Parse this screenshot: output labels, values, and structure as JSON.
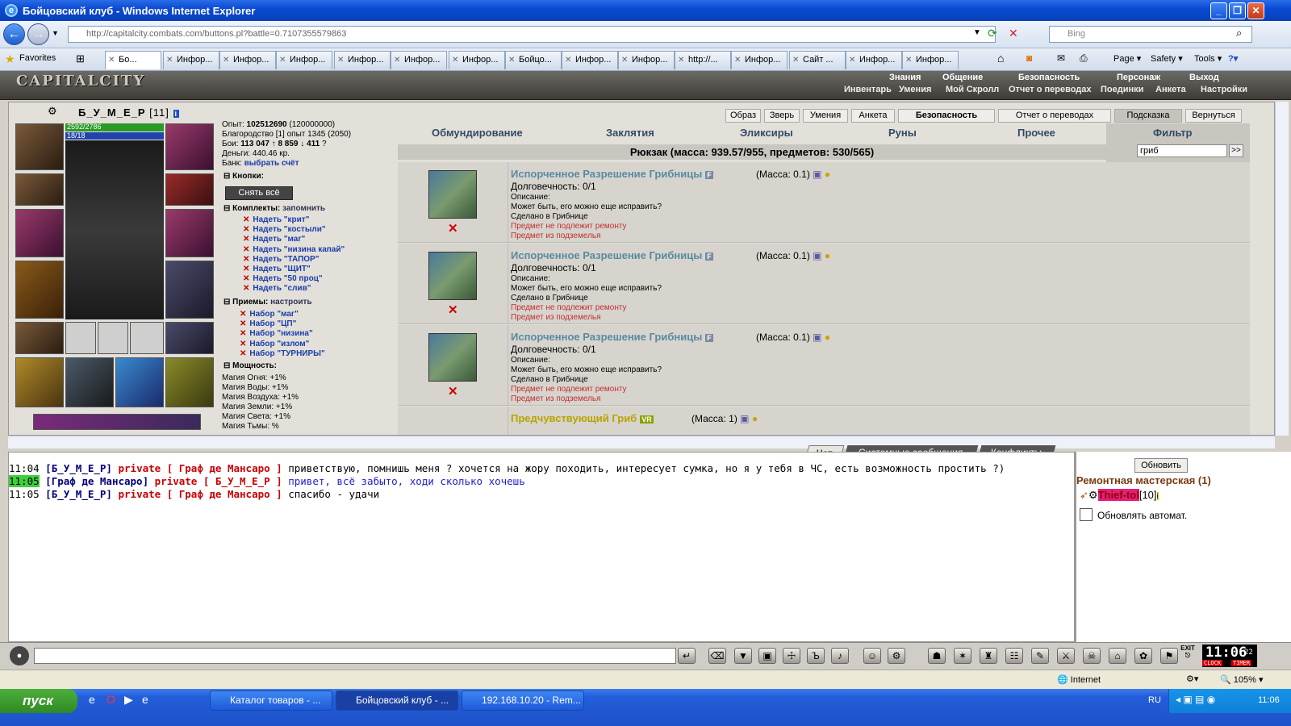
{
  "window": {
    "title": "Бойцовский клуб - Windows Internet Explorer"
  },
  "nav": {
    "address": "http://capitalcity.combats.com/buttons.pl?battle=0.7107355579863",
    "address_host": "combats.com",
    "search_placeholder": "Bing"
  },
  "favorites": "Favorites",
  "tabs": [
    "Бо...",
    "Инфор...",
    "Инфор...",
    "Инфор...",
    "Инфор...",
    "Инфор...",
    "Инфор...",
    "Бойцо...",
    "Инфор...",
    "Инфор...",
    "http://...",
    "Инфор...",
    "Сайт ...",
    "Инфор...",
    "Инфор..."
  ],
  "ie_tools": [
    "Page",
    "Safety",
    "Tools"
  ],
  "game": {
    "logo": "CAPITALCITY",
    "menu_top": [
      "Знания",
      "Общение",
      "Безопасность",
      "Персонаж",
      "Выход"
    ],
    "menu_bottom": [
      "Инвентарь",
      "Умения",
      "Мой Скролл",
      "Отчет о переводах",
      "Поединки",
      "Анкета",
      "Настройки"
    ]
  },
  "character": {
    "name": "Б_У_М_Е_Р",
    "level": "[11]",
    "hp": "2592/2786",
    "mana": "18/18",
    "experience_label": "Опыт:",
    "experience": "102512690",
    "experience_next": "(120000000)",
    "valor": "Благородство [1] опыт 1345 (2050)",
    "fights_label": "Бои:",
    "fights_wins": "113 047",
    "fights_losses": "8 859",
    "fights_draws": "411",
    "money": "Деньги: 440.46 кр.",
    "bank_label": "Банк:",
    "bank_link": "выбрать счёт"
  },
  "buttons_section": {
    "title": "Кнопки:",
    "remove_all": "Снять всё"
  },
  "sets_section": {
    "title": "Комплекты:",
    "action": "запомнить",
    "items": [
      "Надеть \"крит\"",
      "Надеть \"костыли\"",
      "Надеть \"маг\"",
      "Надеть \"низина капай\"",
      "Надеть \"ТАПОР\"",
      "Надеть \"ЩИТ\"",
      "Надеть \"50 проц\"",
      "Надеть \"слив\""
    ]
  },
  "tricks_section": {
    "title": "Приемы:",
    "action": "настроить",
    "items": [
      "Набор \"маг\"",
      "Набор \"ЦП\"",
      "Набор \"низина\"",
      "Набор \"излом\"",
      "Набор \"ТУРНИРЫ\""
    ]
  },
  "power_section": {
    "title": "Мощность:",
    "items": [
      "Магия Огня: +1%",
      "Магия Воды: +1%",
      "Магия Воздуха: +1%",
      "Магия Земли: +1%",
      "Магия Света: +1%",
      "Магия Тьмы: %"
    ]
  },
  "inventory": {
    "top_buttons": [
      "Образ",
      "Зверь",
      "Умения",
      "Анкета",
      "Безопасность",
      "Отчет о переводах",
      "Подсказка",
      "Вернуться"
    ],
    "categories": [
      "Обмундирование",
      "Заклятия",
      "Эликсиры",
      "Руны",
      "Прочее",
      "Фильтр"
    ],
    "backpack": "Рюкзак (масса: 939.57/955, предметов: 530/565)",
    "filter_value": "гриб",
    "filter_go": ">>",
    "items": [
      {
        "name": "Испорченное Разрешение Грибницы",
        "badge": "F",
        "mass": "(Масса: 0.1)",
        "durability": "Долговечность: 0/1",
        "desc_label": "Описание:",
        "desc": "Может быть, его можно еще исправить?",
        "made": "Сделано в Грибнице",
        "note1": "Предмет не подлежит ремонту",
        "note2": "Предмет из подземелья"
      },
      {
        "name": "Испорченное Разрешение Грибницы",
        "badge": "F",
        "mass": "(Масса: 0.1)",
        "durability": "Долговечность: 0/1",
        "desc_label": "Описание:",
        "desc": "Может быть, его можно еще исправить?",
        "made": "Сделано в Грибнице",
        "note1": "Предмет не подлежит ремонту",
        "note2": "Предмет из подземелья"
      },
      {
        "name": "Испорченное Разрешение Грибницы",
        "badge": "F",
        "mass": "(Масса: 0.1)",
        "durability": "Долговечность: 0/1",
        "desc_label": "Описание:",
        "desc": "Может быть, его можно еще исправить?",
        "made": "Сделано в Грибнице",
        "note1": "Предмет не подлежит ремонту",
        "note2": "Предмет из подземелья"
      },
      {
        "name": "Предчувствующий Гриб",
        "badge": "VR",
        "mass": "(Масса: 1)"
      }
    ]
  },
  "chat": {
    "tabs": [
      "Чат",
      "Системные сообщения",
      "Конфликты"
    ],
    "messages": [
      {
        "time": "11:04",
        "from": "[Б_У_М_Е_Р]",
        "private": "private [ Граф де Мансаро ]",
        "text": "приветствую, помнишь меня ? хочется на жору походить, интересует сумка, но я у тебя в ЧС, есть возможность простить ?)"
      },
      {
        "time": "11:05",
        "from": "[Граф де Мансаро]",
        "private": "private [ Б_У_М_Е_Р ]",
        "text": "привет, всё забыто, ходи сколько хочешь"
      },
      {
        "time": "11:05",
        "from": "[Б_У_М_Е_Р]",
        "private": "private [ Граф де Мансаро ]",
        "text": "спасибо - удачи"
      }
    ]
  },
  "room": {
    "refresh": "Обновить",
    "title": "Ремонтная мастерская (1)",
    "user": "Thief-tol",
    "user_level": "[10]",
    "auto_refresh": "Обновлять автомат."
  },
  "clock": {
    "time": "11:06",
    "seconds": "22",
    "label_clock": "CLOCK",
    "label_timer": "TIMER"
  },
  "exit_label": "EXIT",
  "status": {
    "zone": "Internet",
    "zoom": "105%"
  },
  "taskbar": {
    "start": "пуск",
    "tasks": [
      "Каталог товаров - ...",
      "Бойцовский клуб - ...",
      "192.168.10.20 - Rem..."
    ],
    "lang": "RU",
    "time": "11:06"
  }
}
